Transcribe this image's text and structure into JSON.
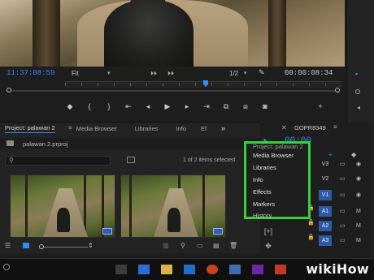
{
  "program_monitor": {
    "timecode_left": "11:37:08:59",
    "fit_label": "Fit",
    "fraction_label": "1/2",
    "timecode_right": "00:00:08:34"
  },
  "project_panel": {
    "tabs": [
      {
        "label": "Project: palawan 2",
        "active": true
      },
      {
        "label": "Media Browser",
        "active": false
      },
      {
        "label": "Libraries",
        "active": false
      },
      {
        "label": "Info",
        "active": false
      },
      {
        "label": "Ef",
        "active": false
      }
    ],
    "overflow_label": "»",
    "file_name": "palawan 2.prproj",
    "selection_status": "1 of 2 items selected"
  },
  "timeline": {
    "sequence_tab": "GOPR8349",
    "timecode": "00:00",
    "tracks": [
      {
        "label": "V3",
        "on": false
      },
      {
        "label": "V2",
        "on": false
      },
      {
        "label": "V1",
        "on": true
      },
      {
        "label": "A1",
        "on": true
      },
      {
        "label": "A2",
        "on": true
      },
      {
        "label": "A3",
        "on": true
      }
    ],
    "track_toggle_letter": "M"
  },
  "overflow_menu": {
    "header": "Project: palawan 2",
    "items": [
      "Media Browser",
      "Libraries",
      "Info",
      "Effects",
      "Markers",
      "History"
    ]
  },
  "watermark": {
    "prefix": "wiki",
    "suffix": "How"
  },
  "colors": {
    "accent": "#2f8cff",
    "highlight_box": "#36d23c"
  }
}
